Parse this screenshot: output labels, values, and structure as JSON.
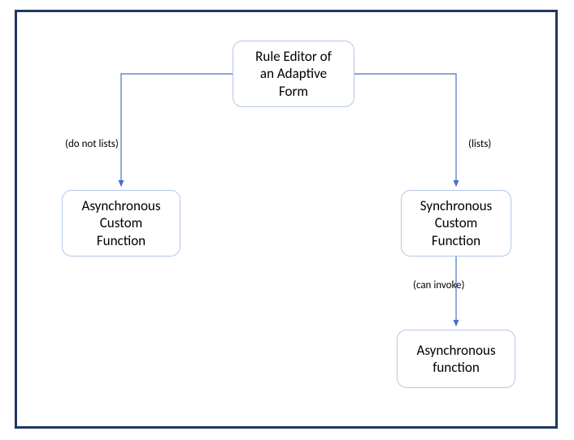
{
  "nodes": {
    "root": "Rule Editor of\nan Adaptive\nForm",
    "asyncCustom": "Asynchronous\nCustom\nFunction",
    "syncCustom": "Synchronous\nCustom\nFunction",
    "asyncFunc": "Asynchronous\nfunction"
  },
  "edges": {
    "doNotLists": "(do not lists)",
    "lists": "(lists)",
    "canInvoke": "(can invoke)"
  },
  "chart_data": {
    "type": "diagram",
    "title": "",
    "nodes": [
      {
        "id": "root",
        "label": "Rule Editor of an Adaptive Form"
      },
      {
        "id": "asyncCustom",
        "label": "Asynchronous Custom Function"
      },
      {
        "id": "syncCustom",
        "label": "Synchronous Custom Function"
      },
      {
        "id": "asyncFunc",
        "label": "Asynchronous function"
      }
    ],
    "edges": [
      {
        "from": "root",
        "to": "asyncCustom",
        "label": "(do not lists)"
      },
      {
        "from": "root",
        "to": "syncCustom",
        "label": "(lists)"
      },
      {
        "from": "syncCustom",
        "to": "asyncFunc",
        "label": "(can invoke)"
      }
    ]
  }
}
